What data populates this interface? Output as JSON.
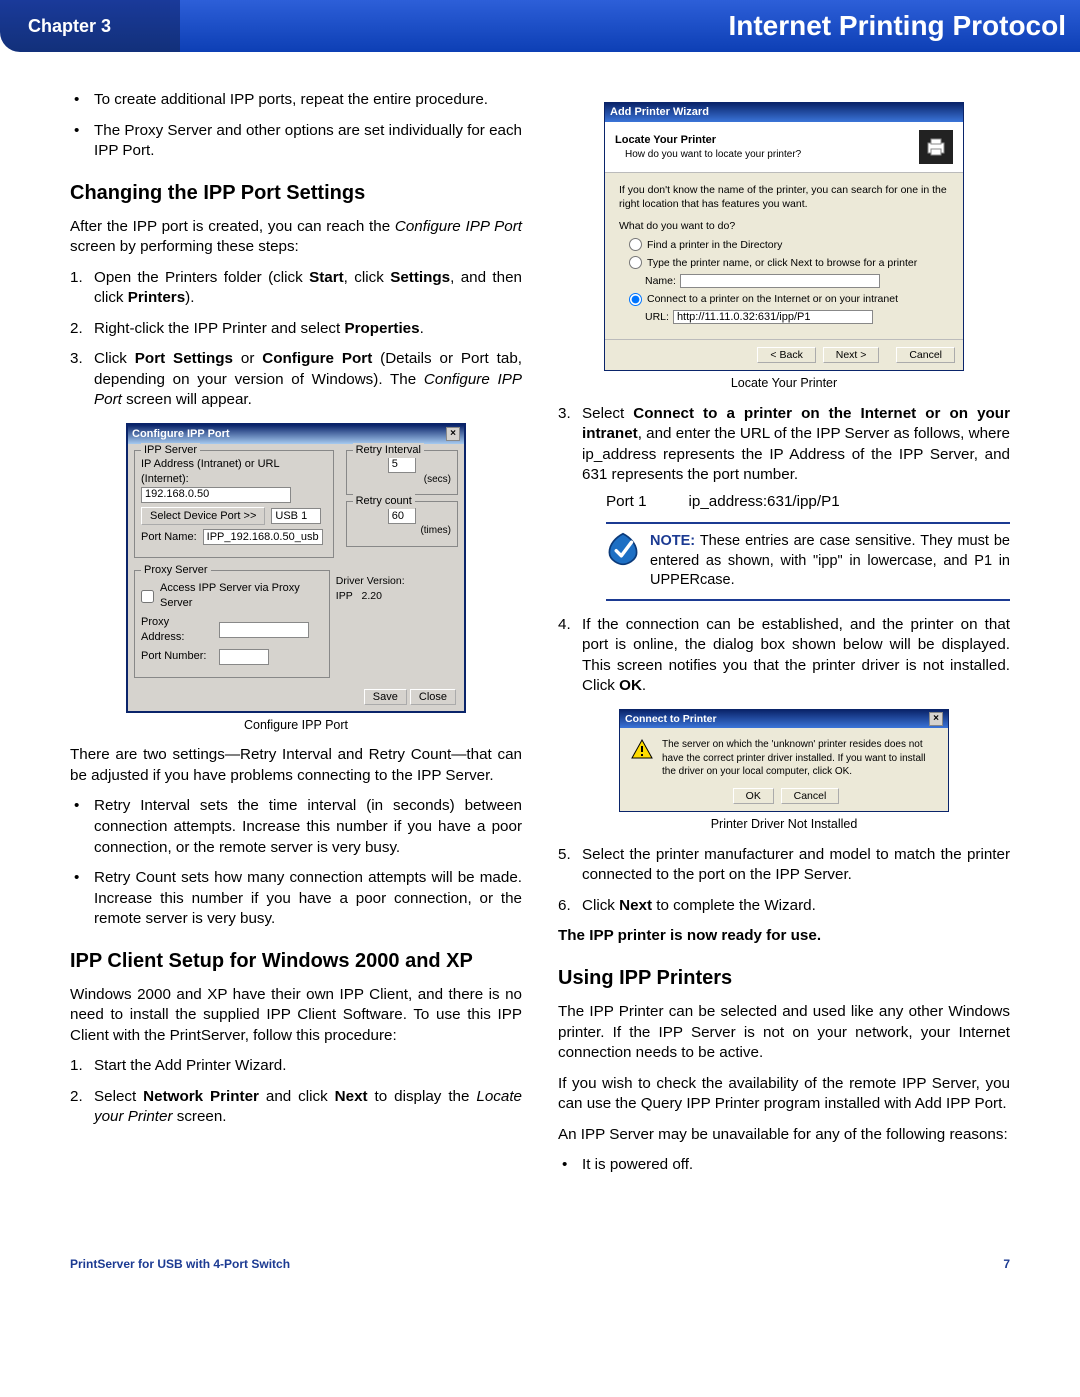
{
  "header": {
    "chapter": "Chapter 3",
    "title": "Internet Printing Protocol"
  },
  "left": {
    "bullets1": [
      "To create additional IPP ports, repeat the entire procedure.",
      "The Proxy Server and other options are set individually for each IPP Port."
    ],
    "h_changing": "Changing the IPP Port Settings",
    "p_after": [
      "After the IPP port is created, you can reach the ",
      "Configure IPP Port",
      " screen by performing these steps:"
    ],
    "steps1": {
      "s1": [
        "Open the Printers folder (click ",
        "Start",
        ", click ",
        "Settings",
        ", and then click ",
        "Printers",
        ")."
      ],
      "s2": [
        "Right-click the IPP Printer and select ",
        "Properties",
        "."
      ],
      "s3": [
        "Click ",
        "Port Settings",
        " or ",
        "Configure Port",
        " (Details or Port tab, depending on your version of Windows). The ",
        "Configure IPP Port",
        " screen will appear."
      ]
    },
    "fig1_cap": "Configure IPP Port",
    "p_two": "There are two settings—Retry Interval and Retry Count—that can be adjusted if you have problems connecting to the IPP Server.",
    "bullets2": [
      "Retry Interval sets the time interval (in seconds) between connection attempts. Increase this number if you have a poor connection, or the remote server is very busy.",
      "Retry Count sets how many connection attempts will be made. Increase this number if you have a poor connection, or the remote server is very busy."
    ],
    "h_client": "IPP Client Setup for Windows 2000 and XP",
    "p_client": "Windows 2000 and XP have their own IPP Client, and there is no need to install the supplied IPP Client Software. To use this IPP Client with the PrintServer, follow this procedure:",
    "steps2": {
      "s1": "Start the Add Printer Wizard.",
      "s2": [
        "Select ",
        "Network Printer",
        " and click ",
        "Next",
        " to display the ",
        "Locate your Printer",
        " screen."
      ]
    }
  },
  "right": {
    "fig2_cap": "Locate Your Printer",
    "steps": {
      "s3": [
        "Select ",
        "Connect to a printer on the Internet or on your intranet",
        ", and enter the URL of the IPP Server as follows, where ip_address represents the IP Address of the IPP Server, and 631 represents the port number."
      ],
      "port_label": "Port 1",
      "port_val": "ip_address:631/ipp/P1",
      "note_label": "NOTE:",
      "note_text": " These entries are case sensitive. They must be entered as shown, with \"ipp\" in lowercase, and P1 in UPPERcase.",
      "s4": [
        "If the connection can be established, and the printer on that port is online, the  dialog box shown below will be displayed. This screen notifies you that the printer driver is not installed. Click ",
        "OK",
        "."
      ],
      "fig3_cap": "Printer Driver Not Installed",
      "s5": "Select the printer manufacturer and model to match the printer connected to the port on the IPP Server.",
      "s6": [
        "Click ",
        "Next",
        " to complete the Wizard."
      ]
    },
    "ready": "The IPP printer is now ready for use.",
    "h_using": "Using IPP Printers",
    "p_using1": "The IPP Printer can be selected and used like any other Windows printer. If the IPP Server is not on your network, your Internet connection needs to be active.",
    "p_using2": "If you wish to check the availability of the remote IPP Server, you can use the Query IPP Printer program installed with Add IPP Port.",
    "p_using3": "An IPP Server may be unavailable for any of the following reasons:",
    "bul_off": "It is powered off."
  },
  "fig_configure": {
    "title": "Configure IPP Port",
    "grp_server": "IPP Server",
    "lbl_ip": "IP Address (Intranet) or URL (Internet):",
    "ip_value": "192.168.0.50",
    "btn_select": "Select Device Port >>",
    "device_value": "USB 1",
    "lbl_portname": "Port Name:",
    "portname_value": "IPP_192.168.0.50_usb",
    "grp_retry_int": "Retry Interval",
    "retry_int_val": "5",
    "retry_int_unit": "(secs)",
    "grp_retry_cnt": "Retry count",
    "retry_cnt_val": "60",
    "retry_cnt_unit": "(times)",
    "grp_proxy": "Proxy Server",
    "chk_proxy": "Access IPP Server via Proxy Server",
    "lbl_proxy_addr": "Proxy Address:",
    "lbl_proxy_port": "Port Number:",
    "lbl_drv": "Driver Version:",
    "drv_name": "IPP",
    "drv_ver": "2.20",
    "btn_save": "Save",
    "btn_close": "Close"
  },
  "fig_wizard": {
    "title": "Add Printer Wizard",
    "head_bold": "Locate Your Printer",
    "head_sub": "How do you want to locate your printer?",
    "hint": "If you don't know the name of the printer, you can search for one in the right location that has features you want.",
    "q": "What do you want to do?",
    "opt1": "Find a printer in the Directory",
    "opt2": "Type the printer name, or click Next to browse for a printer",
    "opt2_lbl": "Name:",
    "opt3": "Connect to a printer on the Internet or on your intranet",
    "opt3_lbl": "URL:",
    "opt3_val": "http://11.11.0.32:631/ipp/P1",
    "btn_back": "< Back",
    "btn_next": "Next >",
    "btn_cancel": "Cancel"
  },
  "fig_msg": {
    "title": "Connect to Printer",
    "text": "The server on which the 'unknown' printer resides does not have the correct printer driver installed. If you want to install the driver on your local computer, click OK.",
    "ok": "OK",
    "cancel": "Cancel"
  },
  "footer": {
    "left": "PrintServer for USB with 4-Port Switch",
    "right": "7"
  }
}
